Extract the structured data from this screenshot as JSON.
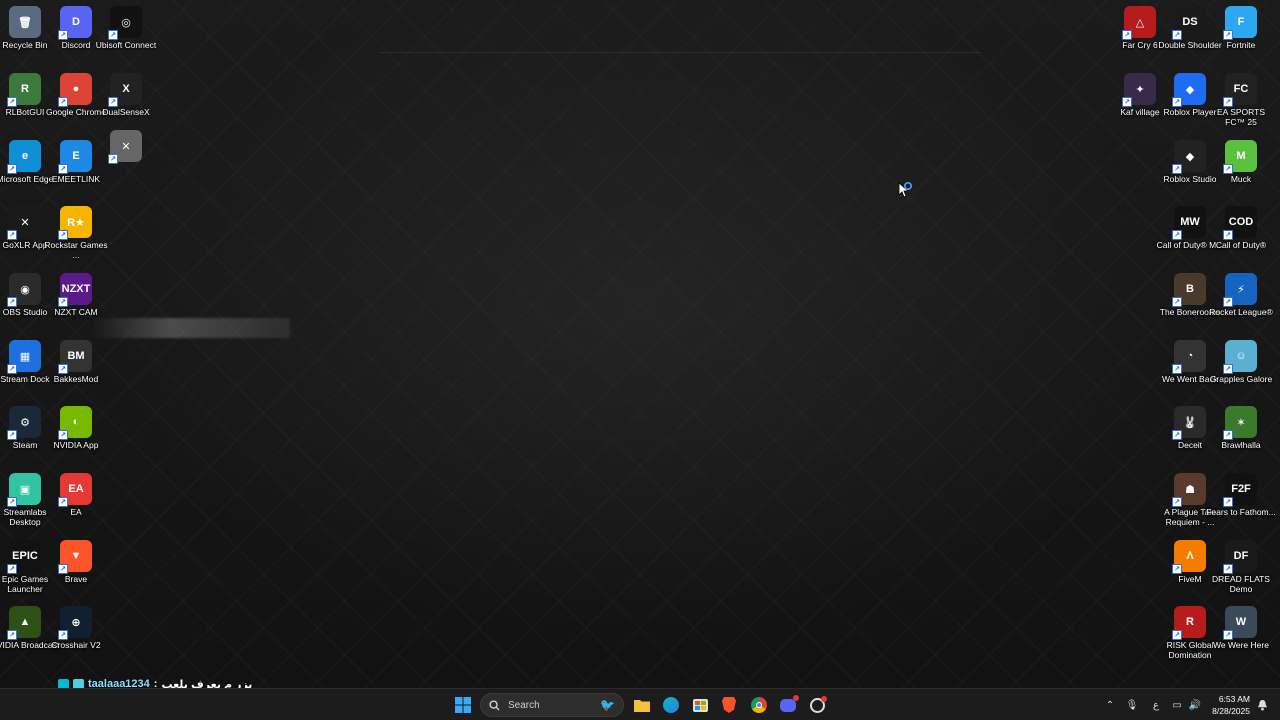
{
  "desktop_icons_left": [
    {
      "label": "Recycle Bin",
      "icon": "recycle-bin-icon",
      "color": "#5a6a80",
      "glyph": "🗑"
    },
    {
      "label": "Discord",
      "icon": "discord-icon",
      "color": "#5865f2",
      "glyph": "D"
    },
    {
      "label": "Ubisoft Connect",
      "icon": "ubisoft-icon",
      "color": "#111111",
      "glyph": "◎"
    },
    {
      "label": "RLBotGUI",
      "icon": "rlbot-icon",
      "color": "#3b7a3b",
      "glyph": "R"
    },
    {
      "label": "Google Chrome",
      "icon": "chrome-icon",
      "color": "#db4437",
      "glyph": "●"
    },
    {
      "label": "DualSenseX",
      "icon": "dualsensex-icon",
      "color": "#222222",
      "glyph": "X"
    },
    {
      "label": "",
      "icon": "unnamed-app-icon",
      "color": "#666666",
      "glyph": "✕"
    },
    {
      "label": "Microsoft Edge",
      "icon": "edge-icon",
      "color": "#0f8fd6",
      "glyph": "e"
    },
    {
      "label": "EMEETLINK",
      "icon": "emeetlink-icon",
      "color": "#1e88e5",
      "glyph": "E"
    },
    {
      "label": "GoXLR App",
      "icon": "goxlr-icon",
      "color": "#1a1a1a",
      "glyph": "✕"
    },
    {
      "label": "Rockstar Games ...",
      "icon": "rockstar-icon",
      "color": "#f5b400",
      "glyph": "R★"
    },
    {
      "label": "OBS Studio",
      "icon": "obs-icon",
      "color": "#2b2b2b",
      "glyph": "◉"
    },
    {
      "label": "NZXT CAM",
      "icon": "nzxt-icon",
      "color": "#5b1a8a",
      "glyph": "NZXT"
    },
    {
      "label": "Stream Dock",
      "icon": "stream-dock-icon",
      "color": "#1e6fe0",
      "glyph": "▦"
    },
    {
      "label": "BakkesMod",
      "icon": "bakkesmod-icon",
      "color": "#333333",
      "glyph": "BM"
    },
    {
      "label": "Steam",
      "icon": "steam-icon",
      "color": "#1b2838",
      "glyph": "⚙"
    },
    {
      "label": "NVIDIA App",
      "icon": "nvidia-icon",
      "color": "#76b900",
      "glyph": "◐"
    },
    {
      "label": "Streamlabs Desktop",
      "icon": "streamlabs-icon",
      "color": "#31c3a2",
      "glyph": "▣"
    },
    {
      "label": "EA",
      "icon": "ea-icon",
      "color": "#e53935",
      "glyph": "EA"
    },
    {
      "label": "Epic Games Launcher",
      "icon": "epic-games-icon",
      "color": "#121212",
      "glyph": "EPIC"
    },
    {
      "label": "Brave",
      "icon": "brave-icon",
      "color": "#fb542b",
      "glyph": "▼"
    },
    {
      "label": "NVIDIA Broadcast",
      "icon": "nvidia-broadcast-icon",
      "color": "#2d5016",
      "glyph": "▲"
    },
    {
      "label": "Crosshair V2",
      "icon": "crosshair-icon",
      "color": "#102030",
      "glyph": "⊕"
    }
  ],
  "desktop_icons_right": [
    {
      "label": "Far Cry 6",
      "icon": "far-cry-icon",
      "color": "#b71c1c",
      "glyph": "△"
    },
    {
      "label": "Double Shoulder",
      "icon": "double-shoulder-icon",
      "color": "#1a1a1a",
      "glyph": "DS"
    },
    {
      "label": "Fortnite",
      "icon": "fortnite-icon",
      "color": "#2ba8f0",
      "glyph": "F"
    },
    {
      "label": "Kaf village",
      "icon": "kaf-village-icon",
      "color": "#3a2a4a",
      "glyph": "✦"
    },
    {
      "label": "Roblox Player",
      "icon": "roblox-player-icon",
      "color": "#1d6cf2",
      "glyph": "◆"
    },
    {
      "label": "EA SPORTS FC™ 25",
      "icon": "ea-fc-icon",
      "color": "#222222",
      "glyph": "FC"
    },
    {
      "label": "Roblox Studio",
      "icon": "roblox-studio-icon",
      "color": "#222222",
      "glyph": "◆"
    },
    {
      "label": "Muck",
      "icon": "muck-icon",
      "color": "#5bbf3f",
      "glyph": "M"
    },
    {
      "label": "Call of Duty® M...",
      "icon": "cod-mw3-icon",
      "color": "#111111",
      "glyph": "MW"
    },
    {
      "label": "Call of Duty®",
      "icon": "cod-icon",
      "color": "#111111",
      "glyph": "COD"
    },
    {
      "label": "The Bonerooms",
      "icon": "bonerooms-icon",
      "color": "#4a3a2a",
      "glyph": "B"
    },
    {
      "label": "Rocket League®",
      "icon": "rocket-league-icon",
      "color": "#1565c0",
      "glyph": "⚡"
    },
    {
      "label": "We Went Back",
      "icon": "we-went-back-icon",
      "color": "#333333",
      "glyph": "◔"
    },
    {
      "label": "Grapples Galore",
      "icon": "grapples-galore-icon",
      "color": "#5ab0d0",
      "glyph": "☺"
    },
    {
      "label": "Deceit",
      "icon": "deceit-icon",
      "color": "#2a2a2a",
      "glyph": "🐰"
    },
    {
      "label": "Brawlhalla",
      "icon": "brawlhalla-icon",
      "color": "#3a7a2a",
      "glyph": "✶"
    },
    {
      "label": "A Plague Tale Requiem - ...",
      "icon": "plague-tale-icon",
      "color": "#5a3a2a",
      "glyph": "☗"
    },
    {
      "label": "Fears to Fathom...",
      "icon": "fears-to-fathom-icon",
      "color": "#111111",
      "glyph": "F2F"
    },
    {
      "label": "FiveM",
      "icon": "fivem-icon",
      "color": "#f57c00",
      "glyph": "Λ"
    },
    {
      "label": "DREAD FLATS Demo",
      "icon": "dread-flats-icon",
      "color": "#1a1a1a",
      "glyph": "DF"
    },
    {
      "label": "RISK Global Domination",
      "icon": "risk-icon",
      "color": "#b71c1c",
      "glyph": "R"
    },
    {
      "label": "We Were Here",
      "icon": "we-were-here-icon",
      "color": "#3a4a5a",
      "glyph": "W"
    }
  ],
  "overlay": {
    "username": "taalaaa1234",
    "separator": ":",
    "message": "بزر م يعرف يلعب"
  },
  "taskbar": {
    "search_placeholder": "Search",
    "pinned": [
      "windows-start-icon",
      "file-explorer-icon",
      "edge-taskbar-icon",
      "store-icon",
      "brave-taskbar-icon",
      "chrome-taskbar-icon",
      "discord-taskbar-icon",
      "crosshair-taskbar-icon"
    ],
    "tray_lang": "ع",
    "time": "6:53 AM",
    "date": "8/28/2025"
  },
  "colors": {
    "taskbar_bg": "#1c1c1c",
    "accent": "#0078d4"
  }
}
